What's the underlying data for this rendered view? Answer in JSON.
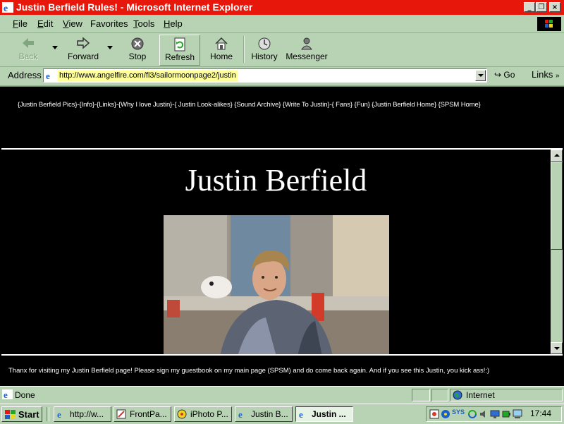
{
  "window": {
    "title": "Justin Berfield Rules! - Microsoft Internet Explorer",
    "minimize_glyph": "_",
    "restore_glyph": "❐",
    "close_glyph": "×"
  },
  "menu": {
    "items": [
      {
        "key": "F",
        "rest": "ile"
      },
      {
        "key": "E",
        "rest": "dit"
      },
      {
        "key": "V",
        "rest": "iew"
      },
      {
        "key": "",
        "rest": "Favorites"
      },
      {
        "key": "T",
        "rest": "ools"
      },
      {
        "key": "H",
        "rest": "elp"
      }
    ]
  },
  "toolbar": {
    "back": "Back",
    "forward": "Forward",
    "stop": "Stop",
    "refresh": "Refresh",
    "home": "Home",
    "history": "History",
    "messenger": "Messenger"
  },
  "address": {
    "label": "Address",
    "url": "http://www.angelfire.com/fl3/sailormoonpage2/justin",
    "go": "Go",
    "links": "Links"
  },
  "page": {
    "nav": "{Justin Berfield Pics}-{Info}-{Links}-{Why I love Justin}-{ Justin Look-alikes} {Sound Archive} {Write To Justin}-{ Fans} {Fun} {Justin Berfield Home} {SPSM Home}",
    "heading": "Justin Berfield",
    "footer": "Thanx for visiting my Justin Berfield page! Please sign my guestbook on my main page (SPSM) and do come back again. And if you see this Justin, you kick ass!:)"
  },
  "status": {
    "text": "Done",
    "zone": "Internet"
  },
  "taskbar": {
    "start": "Start",
    "tasks": [
      {
        "label": "http://w..."
      },
      {
        "label": "FrontPa..."
      },
      {
        "label": "iPhoto P..."
      },
      {
        "label": "Justin B..."
      },
      {
        "label": "Justin ..."
      }
    ],
    "clock": "17:44",
    "tray_text": "SYS"
  },
  "colors": {
    "titlebar": "#e8170b",
    "chrome": "#b7d3b4",
    "page_bg": "#000000",
    "address_highlight": "#ffff99"
  }
}
